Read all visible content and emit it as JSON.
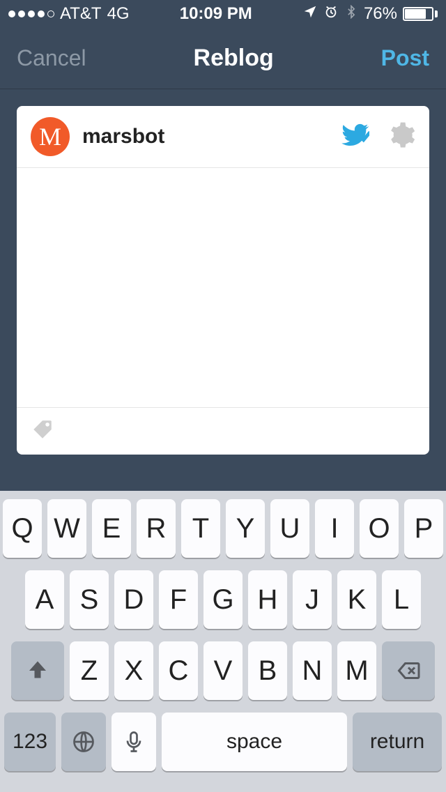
{
  "status": {
    "carrier": "AT&T",
    "network": "4G",
    "time": "10:09 PM",
    "battery_pct": "76%",
    "signal_filled": 4,
    "signal_total": 5
  },
  "nav": {
    "cancel": "Cancel",
    "title": "Reblog",
    "post": "Post"
  },
  "compose": {
    "avatar_letter": "M",
    "username": "marsbot",
    "body_value": "",
    "body_placeholder": ""
  },
  "keyboard": {
    "row1": [
      "Q",
      "W",
      "E",
      "R",
      "T",
      "Y",
      "U",
      "I",
      "O",
      "P"
    ],
    "row2": [
      "A",
      "S",
      "D",
      "F",
      "G",
      "H",
      "J",
      "K",
      "L"
    ],
    "row3": [
      "Z",
      "X",
      "C",
      "V",
      "B",
      "N",
      "M"
    ],
    "numbers_key": "123",
    "space_key": "space",
    "return_key": "return"
  }
}
